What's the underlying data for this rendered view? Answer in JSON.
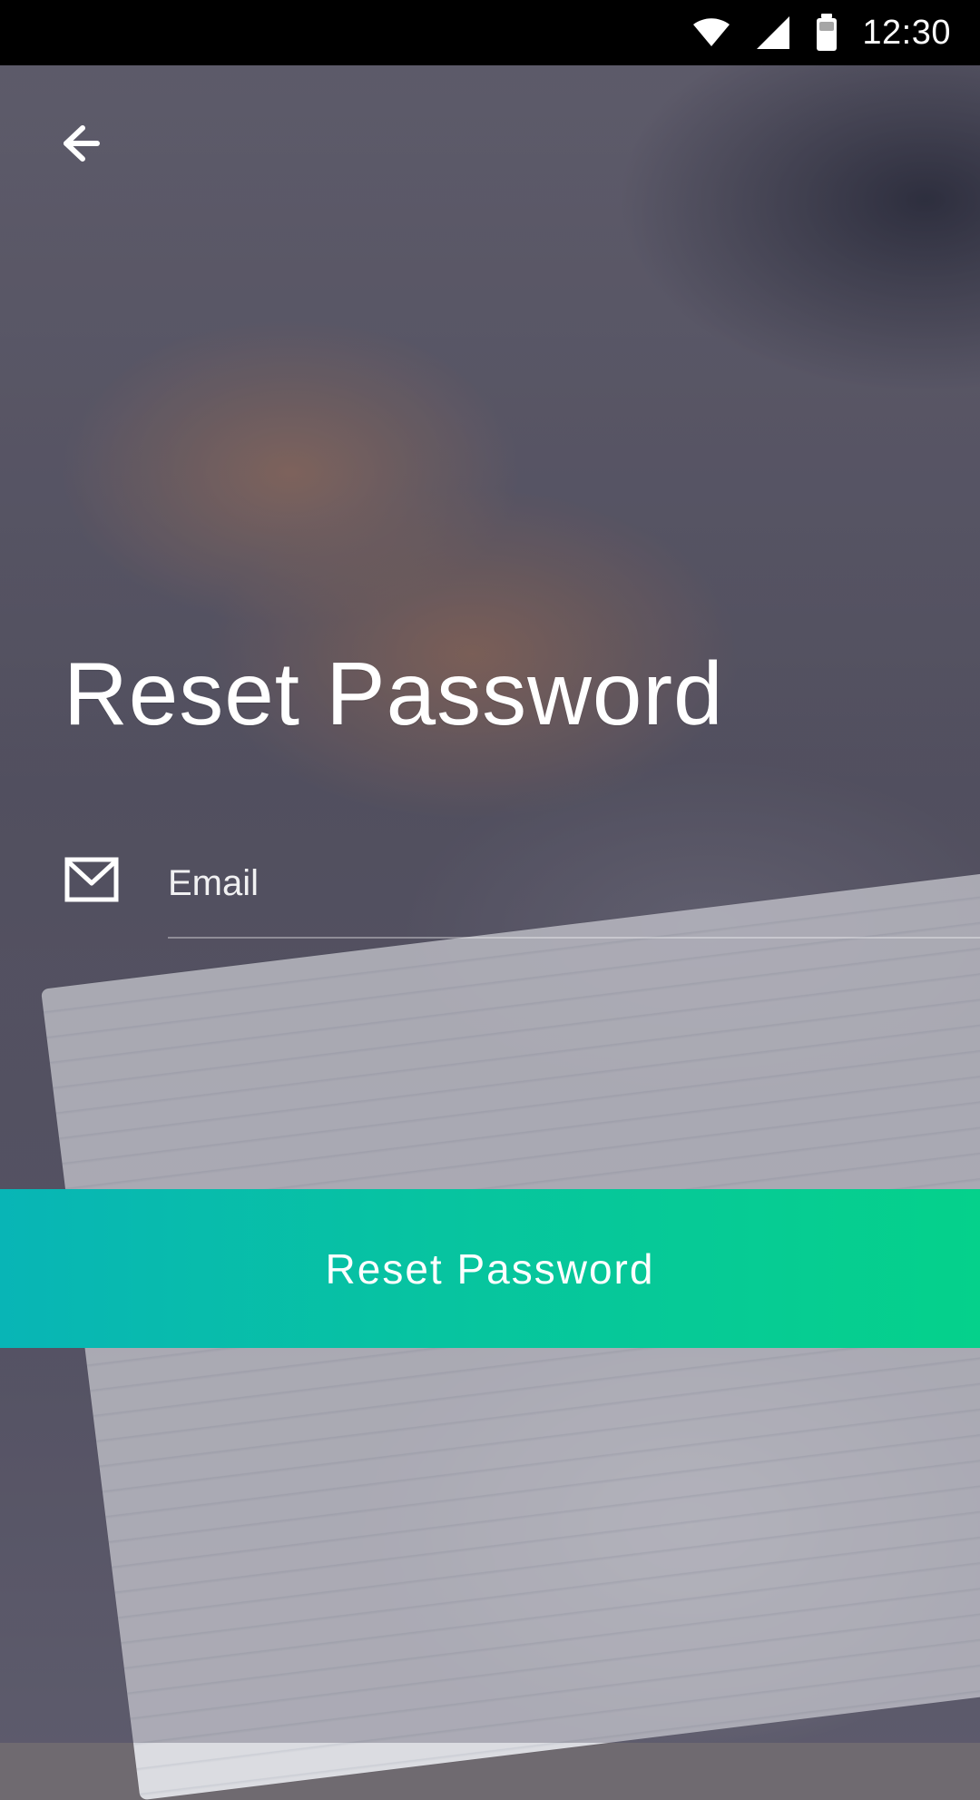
{
  "status_bar": {
    "time": "12:30",
    "icons": [
      "wifi-icon",
      "cellular-signal-icon",
      "battery-icon"
    ]
  },
  "navigation": {
    "back_icon": "arrow-left-icon"
  },
  "screen": {
    "title": "Reset Password"
  },
  "form": {
    "email": {
      "icon": "mail-icon",
      "placeholder": "Email",
      "value": ""
    }
  },
  "actions": {
    "reset_button_label": "Reset Password"
  },
  "colors": {
    "status_bar_bg": "#000000",
    "text": "#ffffff",
    "cta_gradient_start": "#08b5b6",
    "cta_gradient_end": "#05d18b"
  }
}
